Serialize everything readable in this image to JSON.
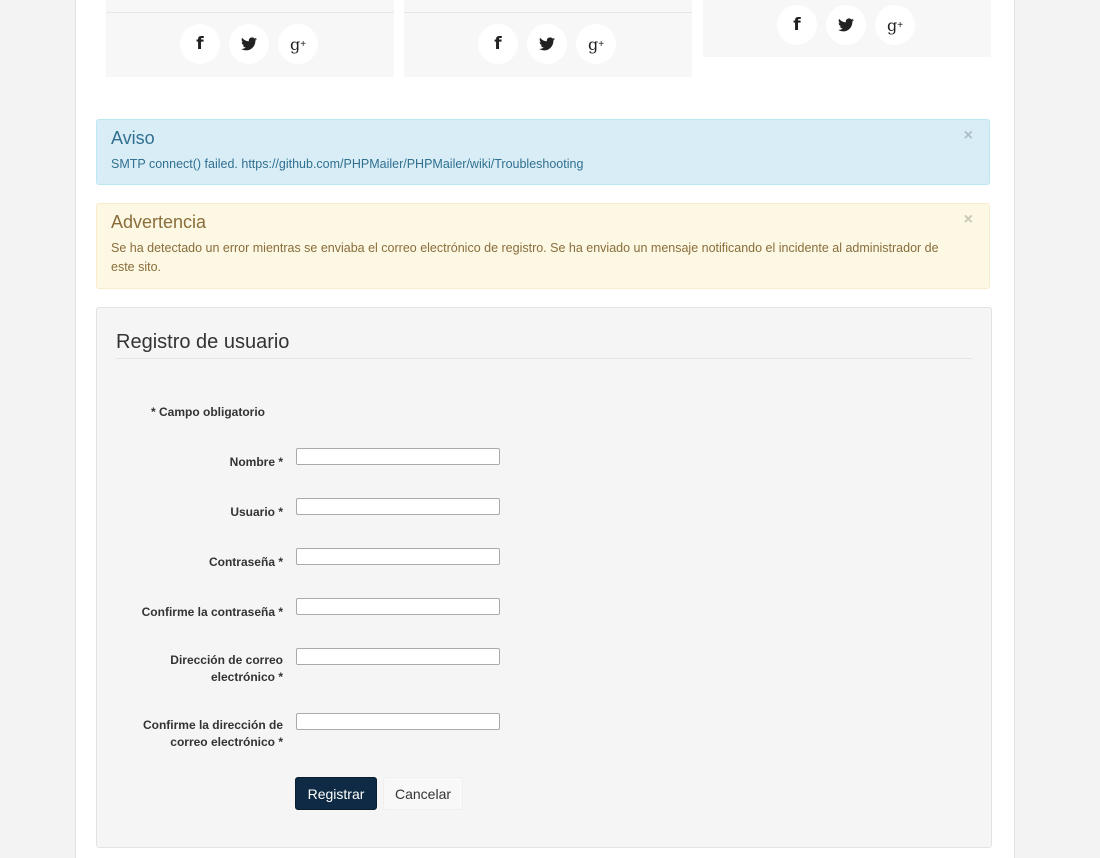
{
  "social_cards": [
    {
      "icons": [
        "facebook-icon",
        "twitter-icon",
        "google-plus-icon"
      ]
    },
    {
      "icons": [
        "facebook-icon",
        "twitter-icon",
        "google-plus-icon"
      ]
    },
    {
      "icons": [
        "facebook-icon",
        "twitter-icon",
        "google-plus-icon"
      ]
    }
  ],
  "social_glyphs": {
    "facebook": "f",
    "twitter": "🐦",
    "gplus": "g",
    "plus": "+"
  },
  "alerts": {
    "info": {
      "title": "Aviso",
      "message": "SMTP connect() failed. https://github.com/PHPMailer/PHPMailer/wiki/Troubleshooting",
      "close": "×"
    },
    "warning": {
      "title": "Advertencia",
      "message": "Se ha detectado un error mientras se enviaba el correo electrónico de registro. Se ha enviado un mensaje notificando el incidente al administrador de este sito.",
      "close": "×"
    }
  },
  "form": {
    "title": "Registro de usuario",
    "required_note": "* Campo obligatorio",
    "fields": [
      {
        "label": "Nombre *",
        "value": ""
      },
      {
        "label": "Usuario *",
        "value": ""
      },
      {
        "label": "Contraseña *",
        "value": ""
      },
      {
        "label": "Confirme la contraseña *",
        "value": ""
      },
      {
        "label": "Dirección de correo electrónico *",
        "value": ""
      },
      {
        "label": "Confirme la dirección de correo electrónico *",
        "value": ""
      }
    ],
    "submit_label": "Registrar",
    "cancel_label": "Cancelar"
  },
  "colors": {
    "info_bg": "#d9edf7",
    "info_text": "#31708f",
    "warning_bg": "#fcf8e3",
    "warning_text": "#8a6d3b",
    "primary_button": "#0f2a44"
  }
}
